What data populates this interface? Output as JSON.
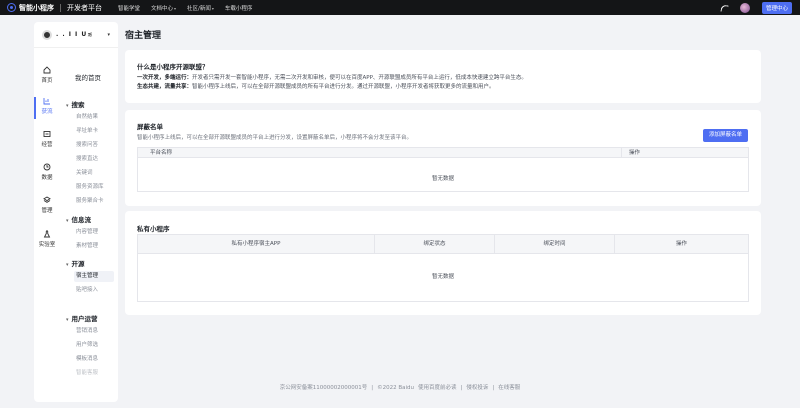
{
  "topbar": {
    "brand_name": "智能小程序",
    "brand_sub": "开发者平台",
    "nav": [
      {
        "label": "智能学堂",
        "has_caret": false
      },
      {
        "label": "文档中心",
        "has_caret": true
      },
      {
        "label": "社区/新闻",
        "has_caret": true
      },
      {
        "label": "车载小程序",
        "has_caret": false
      }
    ],
    "management_button": "管理中心",
    "accent_color": "#4e6ef2"
  },
  "account": {
    "name": ". . I I U≲"
  },
  "rail": [
    {
      "label": "首页",
      "icon": "home-icon",
      "active": false
    },
    {
      "label": "获流",
      "icon": "traffic-icon",
      "active": true
    },
    {
      "label": "经营",
      "icon": "business-icon",
      "active": false
    },
    {
      "label": "数据",
      "icon": "data-icon",
      "active": false
    },
    {
      "label": "管理",
      "icon": "layers-icon",
      "active": false
    },
    {
      "label": "实验室",
      "icon": "flask-icon",
      "active": false
    }
  ],
  "menu": {
    "home": "我的首页",
    "groups": [
      {
        "title": "搜索",
        "items": [
          "自然结果",
          "寻址单卡",
          "搜索问答",
          "搜索直达",
          "关键词",
          "服务资源库",
          "服务聚合卡"
        ]
      },
      {
        "title": "信息流",
        "items": [
          "内容管理",
          "素材管理"
        ]
      },
      {
        "title": "开源",
        "items": [
          "宿主管理",
          "贴吧接入"
        ]
      },
      {
        "title": "用户运营",
        "items": [
          "营销消息",
          "用户筛选",
          "模板消息",
          "智能客服"
        ]
      }
    ],
    "active_item": "宿主管理"
  },
  "page_title": "宿主管理",
  "intro": {
    "title": "什么是小程序开源联盟？",
    "line1_bold": "一次开发，多端运行：",
    "line1": "开发者只需开发一套智能小程序，无需二次开发和审核，便可以在百度APP、开源联盟成员所有平台上运行，低成本快速建立跨平台生态。",
    "line2_bold": "生态共建，流量共享：",
    "line2": "智能小程序上线后，可以在全部开源联盟成员的所有平台进行分发。通过开源联盟，小程序开发者将获取更多的流量和用户。"
  },
  "blocklist": {
    "title": "屏蔽名单",
    "desc": "智能小程序上线后，可以在全部开源联盟成员的平台上进行分发，设置屏蔽名单后，小程序将不会分发至该平台。",
    "add_button": "添加屏蔽名单",
    "columns": [
      "平台名称",
      "操作"
    ],
    "empty": "暂无数据"
  },
  "private_apps": {
    "title": "私有小程序",
    "columns": [
      "私有小程序宿主APP",
      "绑定状态",
      "绑定时间",
      "操作"
    ],
    "empty": "暂无数据"
  },
  "footer": [
    "京公网安备案11000002000001号",
    "|",
    "©2022 Baidu",
    "使用百度前必读",
    "|",
    "侵权投诉",
    "|",
    "在线客服"
  ]
}
